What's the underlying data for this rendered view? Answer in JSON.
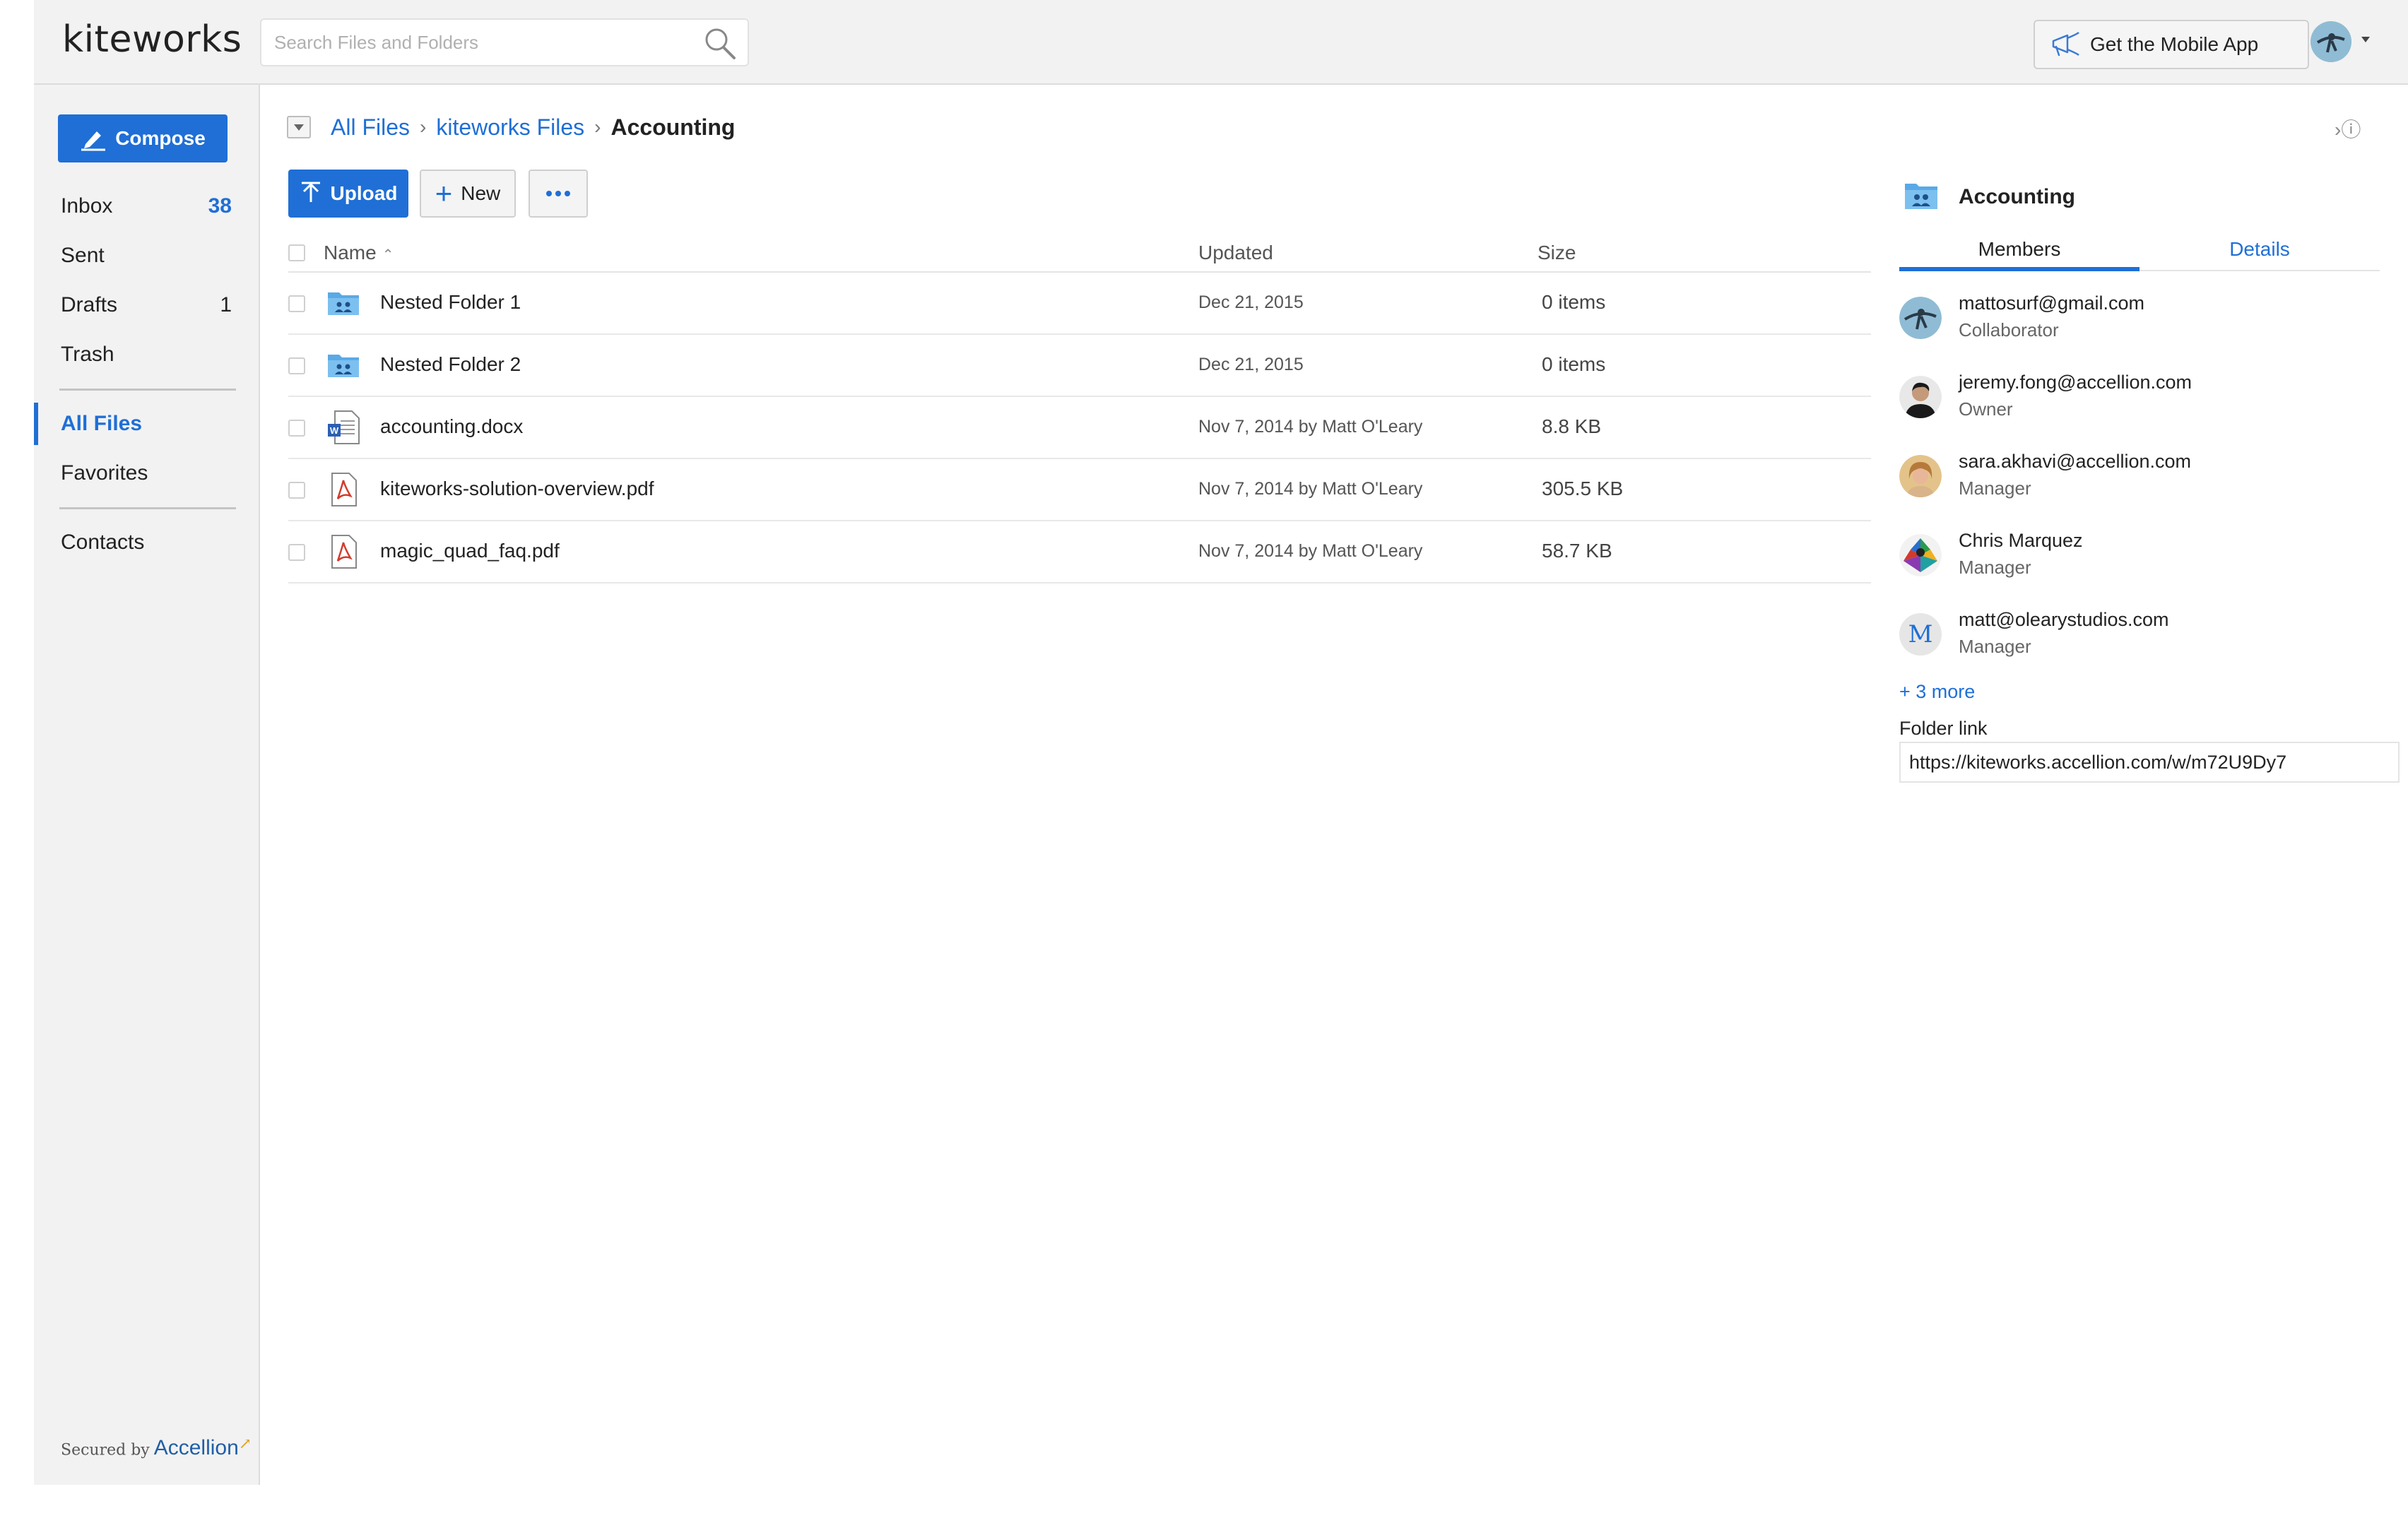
{
  "app": {
    "logo_text": "kiteworks"
  },
  "header": {
    "search_placeholder": "Search Files and Folders",
    "search_value": "",
    "mobile_app_label": "Get the Mobile App"
  },
  "sidebar": {
    "compose_label": "Compose",
    "items": [
      {
        "label": "Inbox",
        "count": "38"
      },
      {
        "label": "Sent",
        "count": ""
      },
      {
        "label": "Drafts",
        "count": "1"
      },
      {
        "label": "Trash",
        "count": ""
      },
      {
        "label": "All Files",
        "count": ""
      },
      {
        "label": "Favorites",
        "count": ""
      },
      {
        "label": "Contacts",
        "count": ""
      }
    ],
    "secured_by": "Secured by",
    "secured_brand": "Accellion"
  },
  "breadcrumb": {
    "items": [
      "All Files",
      "kiteworks Files"
    ],
    "current": "Accounting"
  },
  "toolbar": {
    "upload_label": "Upload",
    "new_label": "New"
  },
  "table": {
    "columns": {
      "name": "Name",
      "updated": "Updated",
      "size": "Size"
    },
    "rows": [
      {
        "name": "Nested Folder 1",
        "updated": "Dec 21, 2015",
        "size": "0 items",
        "icon": "shared-folder-icon"
      },
      {
        "name": "Nested Folder 2",
        "updated": "Dec 21, 2015",
        "size": "0 items",
        "icon": "shared-folder-icon"
      },
      {
        "name": "accounting.docx",
        "updated": "Nov 7, 2014 by Matt O'Leary",
        "size": "8.8 KB",
        "icon": "word-doc-icon"
      },
      {
        "name": "kiteworks-solution-overview.pdf",
        "updated": "Nov 7, 2014 by Matt O'Leary",
        "size": "305.5 KB",
        "icon": "pdf-icon"
      },
      {
        "name": "magic_quad_faq.pdf",
        "updated": "Nov 7, 2014 by Matt O'Leary",
        "size": "58.7 KB",
        "icon": "pdf-icon"
      }
    ]
  },
  "panel": {
    "title": "Accounting",
    "tabs": {
      "members": "Members",
      "details": "Details"
    },
    "members": [
      {
        "email": "mattosurf@gmail.com",
        "role": "Collaborator"
      },
      {
        "email": "jeremy.fong@accellion.com",
        "role": "Owner"
      },
      {
        "email": "sara.akhavi@accellion.com",
        "role": "Manager"
      },
      {
        "email": "Chris Marquez",
        "role": "Manager"
      },
      {
        "email": "matt@olearystudios.com",
        "role": "Manager",
        "initial": "M"
      }
    ],
    "more_members": "+ 3 more",
    "folder_link_label": "Folder link",
    "folder_link_value": "https://kiteworks.accellion.com/w/m72U9Dy7"
  },
  "colors": {
    "accent": "#1f6fd6",
    "sidebar_bg": "#f2f2f2",
    "header_bg": "#f2f2f2"
  }
}
